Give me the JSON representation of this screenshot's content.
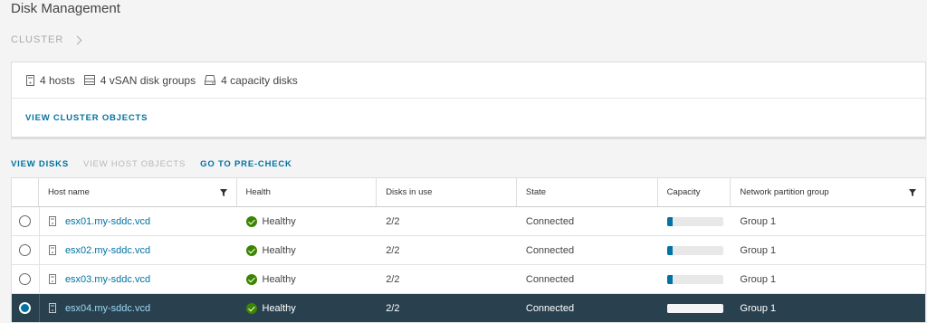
{
  "page": {
    "title": "Disk Management",
    "breadcrumb": "CLUSTER"
  },
  "summary": {
    "hosts": "4 hosts",
    "disk_groups": "4 vSAN disk groups",
    "capacity_disks": "4 capacity disks",
    "view_cluster_objects": "VIEW CLUSTER OBJECTS"
  },
  "tabs": {
    "view_disks": "VIEW DISKS",
    "view_host_objects": "VIEW HOST OBJECTS",
    "go_to_precheck": "GO TO PRE-CHECK"
  },
  "grid": {
    "columns": [
      "Host name",
      "Health",
      "Disks in use",
      "State",
      "Capacity",
      "Network partition group"
    ],
    "rows": [
      {
        "host": "esx01.my-sddc.vcd",
        "health": "Healthy",
        "disks": "2/2",
        "state": "Connected",
        "capacity_fraction": 0.1,
        "group": "Group 1",
        "selected": false
      },
      {
        "host": "esx02.my-sddc.vcd",
        "health": "Healthy",
        "disks": "2/2",
        "state": "Connected",
        "capacity_fraction": 0.1,
        "group": "Group 1",
        "selected": false
      },
      {
        "host": "esx03.my-sddc.vcd",
        "health": "Healthy",
        "disks": "2/2",
        "state": "Connected",
        "capacity_fraction": 0.1,
        "group": "Group 1",
        "selected": false
      },
      {
        "host": "esx04.my-sddc.vcd",
        "health": "Healthy",
        "disks": "2/2",
        "state": "Connected",
        "capacity_fraction": 0.1,
        "group": "Group 1",
        "selected": true
      }
    ]
  },
  "icons": {
    "host": "server-icon",
    "disk_group": "disk-group-icon",
    "capacity_disk": "hard-disk-icon",
    "filter": "filter-icon",
    "healthy": "check-circle-icon",
    "chevron": "chevron-right-icon"
  },
  "colors": {
    "link": "#0072a3",
    "healthy": "#3c8500",
    "selected_row": "#29414e"
  }
}
